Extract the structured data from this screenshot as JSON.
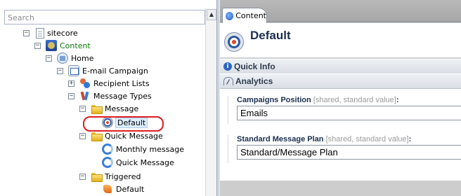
{
  "search": {
    "placeholder": "Search"
  },
  "tree": {
    "expander_minus": "−",
    "expander_plus": "+",
    "items": [
      {
        "label": "sitecore"
      },
      {
        "label": "Content"
      },
      {
        "label": "Home"
      },
      {
        "label": "E-mail Campaign"
      },
      {
        "label": "Recipient Lists"
      },
      {
        "label": "Message Types"
      },
      {
        "label": "Message"
      },
      {
        "label": "Default"
      },
      {
        "label": "Quick Message"
      },
      {
        "label": "Monthly message"
      },
      {
        "label": "Quick Message"
      },
      {
        "label": "Triggered"
      },
      {
        "label": "Default"
      }
    ]
  },
  "scrollbar": {
    "up_arrow": "▲"
  },
  "editor": {
    "tab_label": "Content",
    "item_title": "Default",
    "sections": {
      "quick_info": "Quick Info",
      "analytics": "Analytics",
      "info_glyph": "i"
    },
    "fields": [
      {
        "name": "Campaigns Position",
        "meta": "[shared, standard value]",
        "suffix": ":",
        "value": "Emails"
      },
      {
        "name": "Standard Message Plan",
        "meta": "[shared, standard value]",
        "suffix": ":",
        "value": "Standard/Message Plan"
      }
    ]
  },
  "colors": {
    "highlight_ring": "#e01d22",
    "content_label_green": "#0a7a0a",
    "title_navy": "#1a2e4f"
  }
}
